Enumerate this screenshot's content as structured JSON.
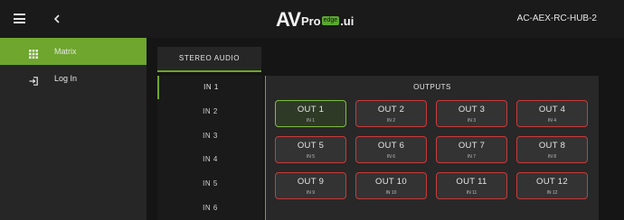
{
  "header": {
    "logo_av": "AV",
    "logo_pro": "Pro",
    "logo_edge": "edge",
    "logo_ui": ".ui",
    "device_name": "AC-AEX-RC-HUB-2"
  },
  "sidebar": {
    "items": [
      {
        "label": "Matrix",
        "icon": "grid-icon",
        "active": true
      },
      {
        "label": "Log In",
        "icon": "login-icon",
        "active": false
      }
    ]
  },
  "main": {
    "tab": {
      "label": "STEREO AUDIO"
    },
    "inputs": [
      {
        "label": "IN 1",
        "active": true
      },
      {
        "label": "IN 2",
        "active": false
      },
      {
        "label": "IN 3",
        "active": false
      },
      {
        "label": "IN 4",
        "active": false
      },
      {
        "label": "IN 5",
        "active": false
      },
      {
        "label": "IN 6",
        "active": false
      }
    ],
    "outputs_title": "OUTPUTS",
    "outputs": [
      {
        "label": "OUT 1",
        "source": "IN 1",
        "active": true
      },
      {
        "label": "OUT 2",
        "source": "IN 2",
        "active": false
      },
      {
        "label": "OUT 3",
        "source": "IN 3",
        "active": false
      },
      {
        "label": "OUT 4",
        "source": "IN 4",
        "active": false
      },
      {
        "label": "OUT 5",
        "source": "IN 5",
        "active": false
      },
      {
        "label": "OUT 6",
        "source": "IN 6",
        "active": false
      },
      {
        "label": "OUT 7",
        "source": "IN 7",
        "active": false
      },
      {
        "label": "OUT 8",
        "source": "IN 8",
        "active": false
      },
      {
        "label": "OUT 9",
        "source": "IN 9",
        "active": false
      },
      {
        "label": "OUT 10",
        "source": "IN 10",
        "active": false
      },
      {
        "label": "OUT 11",
        "source": "IN 11",
        "active": false
      },
      {
        "label": "OUT 12",
        "source": "IN 12",
        "active": false
      }
    ]
  },
  "colors": {
    "accent": "#6ea62e",
    "unrouted_border": "#c93a3a",
    "background": "#151515"
  }
}
